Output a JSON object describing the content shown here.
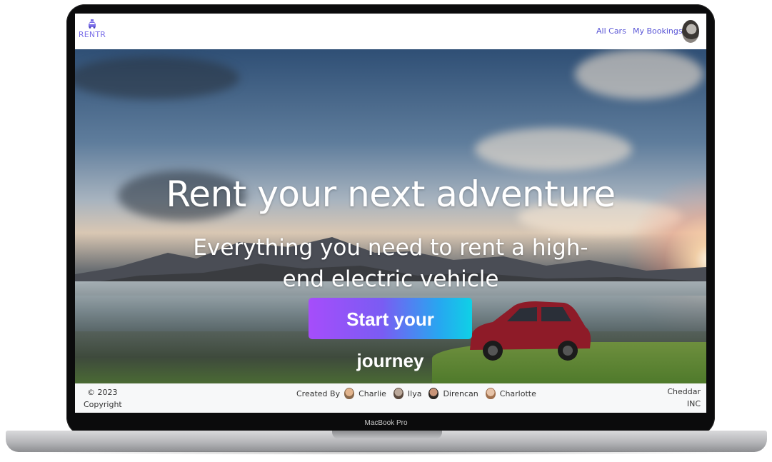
{
  "nav": {
    "logo_text": "RENTR",
    "links": [
      "All Cars",
      "My Bookings"
    ]
  },
  "hero": {
    "title": "Rent your next adventure",
    "subtitle": "Everything you need to rent a high-end electric vehicle",
    "cta_label": "Start your journey"
  },
  "footer": {
    "copyright_line1": "© 2023",
    "copyright_line2": "Copyright",
    "created_by": "Created By",
    "creators": [
      "Charlie",
      "Ilya",
      "Direncan",
      "Charlotte"
    ],
    "company_line1": "Cheddar",
    "company_line2": "INC"
  },
  "device": {
    "label": "MacBook Pro"
  },
  "colors": {
    "brand": "#7a6ee8",
    "link": "#5b57d6",
    "cta_start": "#a64dfb",
    "cta_end": "#0fd1e6"
  },
  "icons": [
    "car-logo-icon",
    "user-avatar",
    "creator-avatar"
  ]
}
